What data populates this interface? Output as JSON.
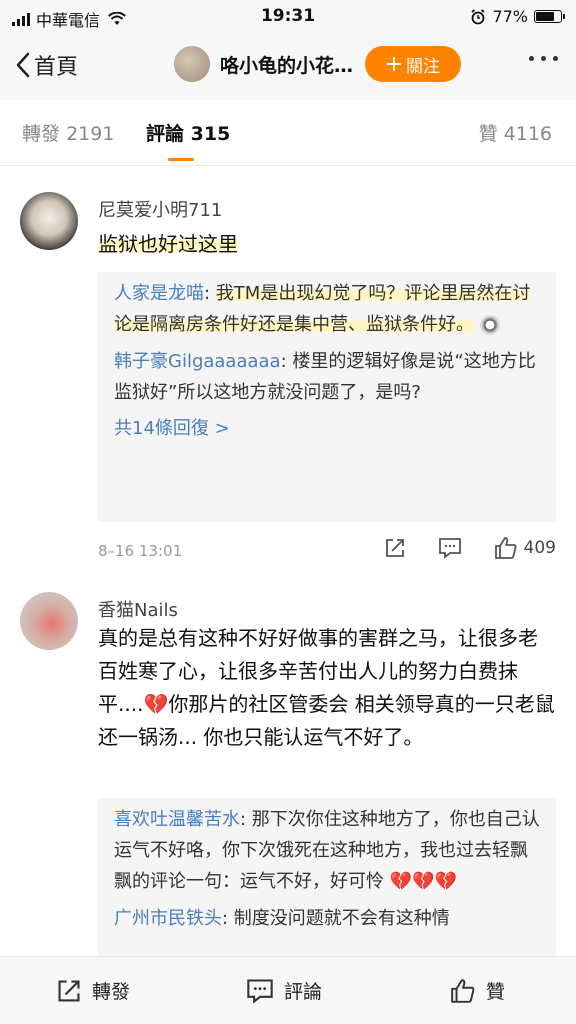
{
  "status_bar": {
    "carrier": "中華電信",
    "time": "19:31",
    "battery": "77%"
  },
  "nav": {
    "back_label": "首頁",
    "title": "咯小龟的小花…",
    "follow_label": "關注"
  },
  "tabs": [
    {
      "label": "轉發",
      "count": "2191"
    },
    {
      "label": "評論",
      "count": "315"
    },
    {
      "label": "贊",
      "count": "4116"
    }
  ],
  "comments": [
    {
      "username": "尼莫爱小明711",
      "text": "监狱也好过这里",
      "replies": [
        {
          "name": "人家是龙喵",
          "text": "我TM是出现幻觉了吗？评论里居然在讨论是隔离房条件好还是集中营、监狱条件好。"
        },
        {
          "name": "韩子豪Gilgaaaaaaa",
          "text": "楼里的逻辑好像是说“这地方比监狱好”所以这地方就没问题了，是吗?"
        }
      ],
      "more_replies": "共14條回復 >",
      "time": "8–16 13:01",
      "likes": "409"
    },
    {
      "username": "香猫Nails",
      "text_part1": "真的是总有这种不好好做事的害群之马，让很多老百姓寒了心，让很多辛苦付出人儿的努力白费抹平....",
      "text_part2": "你那片的社区管委会 相关领导真的一只老鼠还一锅汤... 你也只能认运气不好了。",
      "replies": [
        {
          "name": "喜欢吐温馨苦水",
          "text": "那下次你住这种地方了，你也自己认运气不好咯，你下次饿死在这种地方，我也过去轻飘飘的评论一句：运气不好，好可怜"
        },
        {
          "name": "广州市民铁头",
          "text": "制度没问题就不会有这种情"
        }
      ]
    }
  ],
  "bottom_bar": {
    "repost_label": "轉發",
    "comment_label": "評論",
    "like_label": "贊"
  },
  "colors": {
    "accent": "#ff8200",
    "link": "#4a7fbf",
    "heart": "#d0202a"
  }
}
